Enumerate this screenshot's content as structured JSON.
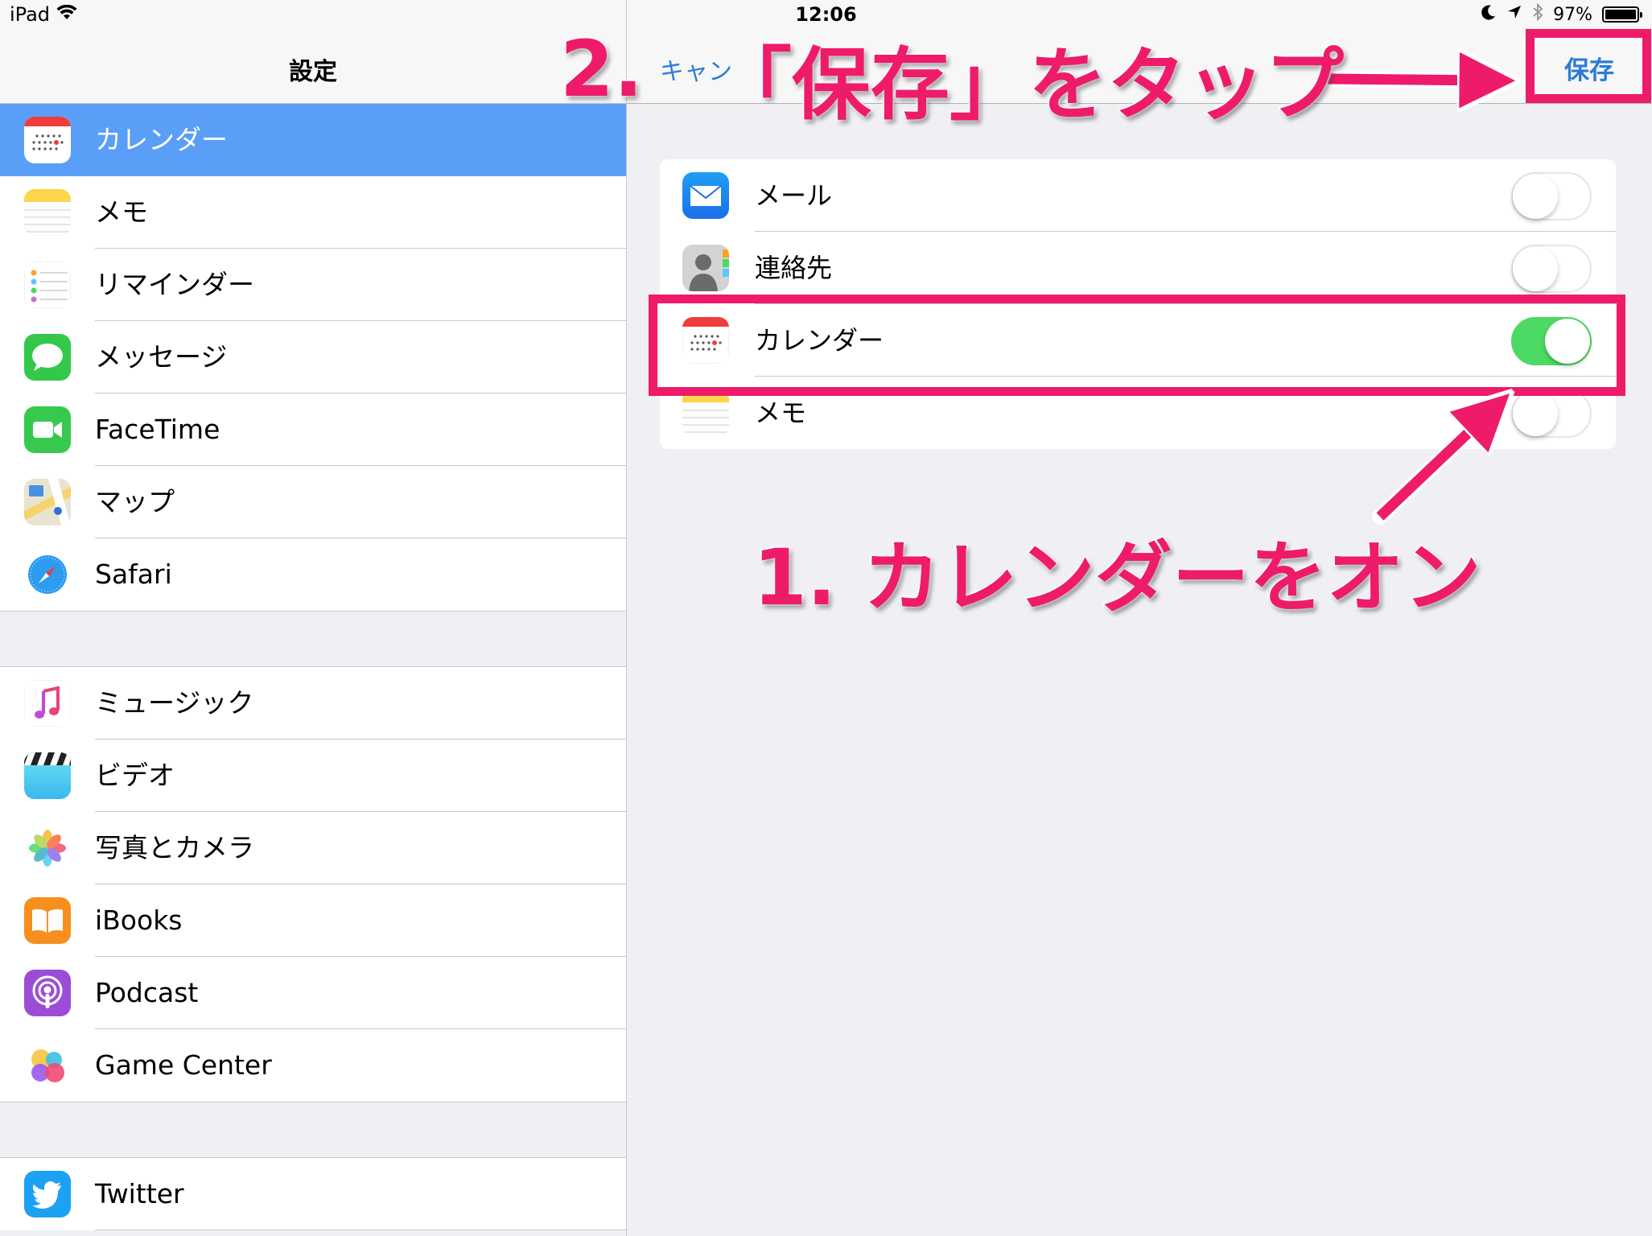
{
  "status_bar": {
    "device": "iPad",
    "time": "12:06",
    "battery": "97%"
  },
  "master": {
    "title": "設定",
    "group1": [
      {
        "label": "カレンダー",
        "icon": "calendar-icon",
        "selected": true
      },
      {
        "label": "メモ",
        "icon": "notes-icon"
      },
      {
        "label": "リマインダー",
        "icon": "reminders-icon"
      },
      {
        "label": "メッセージ",
        "icon": "messages-icon"
      },
      {
        "label": "FaceTime",
        "icon": "facetime-icon"
      },
      {
        "label": "マップ",
        "icon": "maps-icon"
      },
      {
        "label": "Safari",
        "icon": "safari-icon"
      }
    ],
    "group2": [
      {
        "label": "ミュージック",
        "icon": "music-icon"
      },
      {
        "label": "ビデオ",
        "icon": "videos-icon"
      },
      {
        "label": "写真とカメラ",
        "icon": "photos-icon"
      },
      {
        "label": "iBooks",
        "icon": "ibooks-icon"
      },
      {
        "label": "Podcast",
        "icon": "podcast-icon"
      },
      {
        "label": "Game Center",
        "icon": "game-center-icon"
      }
    ],
    "group3": [
      {
        "label": "Twitter",
        "icon": "twitter-icon"
      }
    ]
  },
  "detail": {
    "cancel_label": "キャン",
    "save_label": "保存",
    "rows": [
      {
        "label": "メール",
        "icon": "mail-icon",
        "on": false
      },
      {
        "label": "連絡先",
        "icon": "contacts-icon",
        "on": false
      },
      {
        "label": "カレンダー",
        "icon": "calendar-icon",
        "on": true
      },
      {
        "label": "メモ",
        "icon": "notes-icon",
        "on": false
      }
    ]
  },
  "annotations": {
    "step2_number": "2.",
    "step2_text": "「保存」をタップ",
    "step1_text": "1. カレンダーをオン"
  },
  "colors": {
    "accent": "#2b7bd9",
    "selection": "#5a9ff7",
    "toggle_on": "#4cd964",
    "annotation": "#ee1b6b"
  }
}
